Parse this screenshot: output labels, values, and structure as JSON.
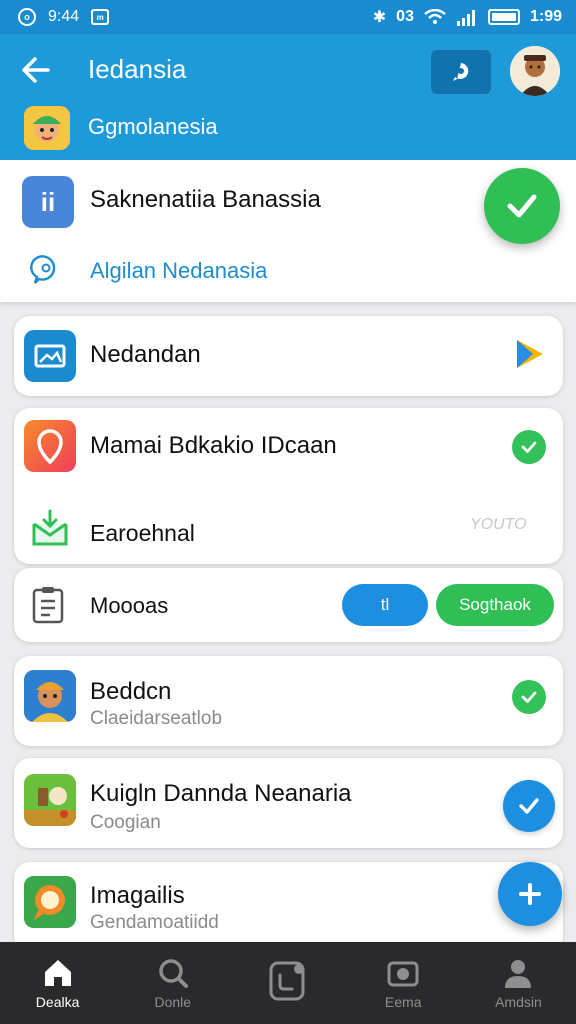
{
  "status_bar": {
    "left_text": "9:44",
    "signal_label": "03",
    "time": "1:99"
  },
  "header": {
    "title": "Iedansia",
    "subtitle": "Ggmolanesia",
    "back_icon": "arrow-left-icon",
    "action_icon": "chat-bubble-icon"
  },
  "top_panel": {
    "icon_text": "ii",
    "title": "Saknenatiia Banassia",
    "link": "Algilan Nedanasia"
  },
  "cards": [
    {
      "title": "Nedandan",
      "trailing_icon": "play-icon"
    },
    {
      "title": "Mamai Bdkakio IDcaan",
      "secondary": "Earoehnal",
      "secondary_trailing": "YOUTO"
    },
    {
      "title": "Moooas",
      "pill_left": "tl",
      "pill_right": "Sogthaok"
    },
    {
      "title": "Beddcn",
      "subtitle": "Claeidarseatlob"
    },
    {
      "title": "Kuigln Dannda Neanaria",
      "subtitle": "Coogian"
    },
    {
      "title": "Imagailis",
      "subtitle": "Gendamoatiidd"
    }
  ],
  "bottom_nav": [
    {
      "label": "Dealka",
      "icon": "home-icon",
      "active": true
    },
    {
      "label": "Donle",
      "icon": "search-icon",
      "active": false
    },
    {
      "label": "",
      "icon": "chat-icon",
      "active": false
    },
    {
      "label": "Eema",
      "icon": "camera-icon",
      "active": false
    },
    {
      "label": "Amdsin",
      "icon": "person-icon",
      "active": false
    }
  ],
  "colors": {
    "header": "#1e9ad8",
    "green": "#2fbf55",
    "blue": "#1d8fe0"
  }
}
